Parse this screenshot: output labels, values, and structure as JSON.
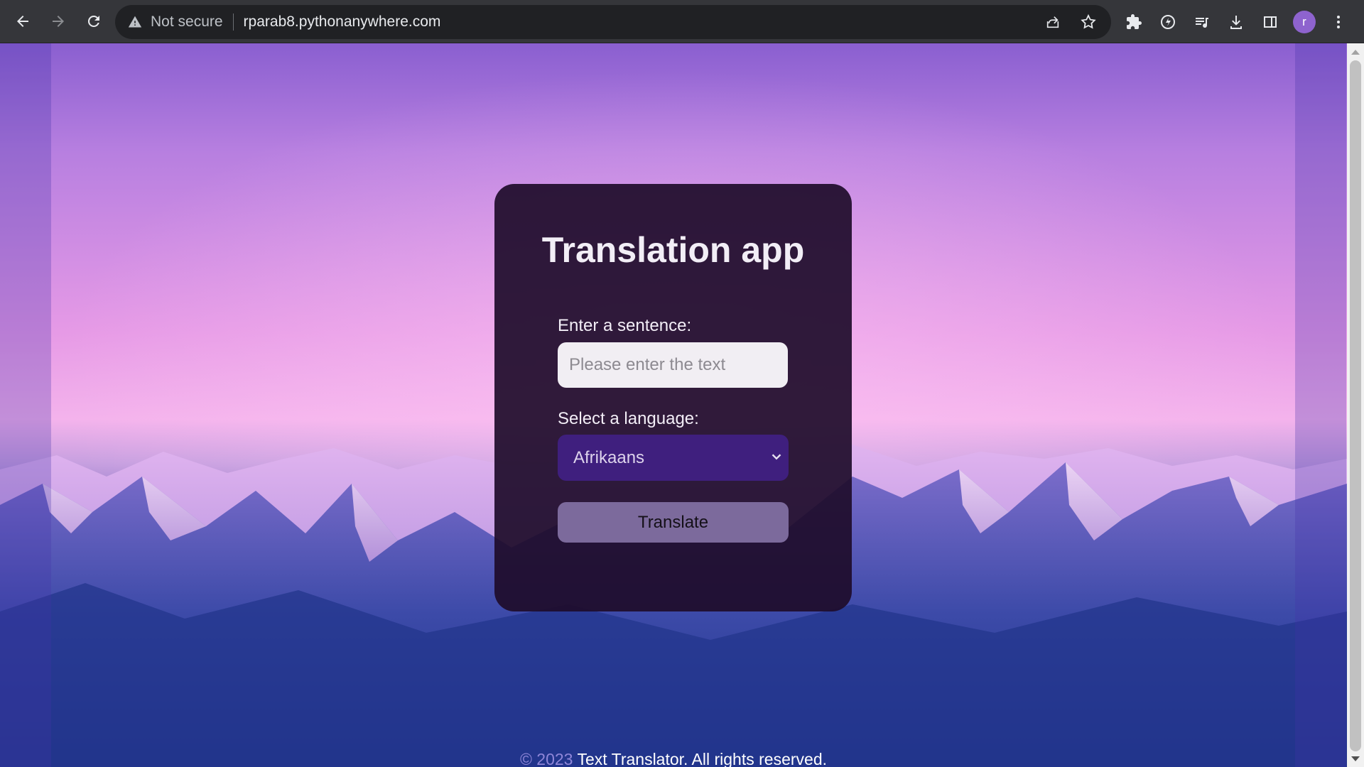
{
  "browser": {
    "security_label": "Not secure",
    "url": "rparab8.pythonanywhere.com",
    "profile_initial": "r",
    "profile_color": "#8e63ce"
  },
  "app": {
    "title": "Translation app",
    "sentence_label": "Enter a sentence:",
    "sentence_placeholder": "Please enter the text",
    "sentence_value": "",
    "language_label": "Select a language:",
    "language_selected": "Afrikaans",
    "translate_label": "Translate"
  },
  "footer": {
    "copyright": "© 2023",
    "text": "Text Translator. All rights reserved."
  },
  "colors": {
    "card_background": "#1e0c2a",
    "select_background": "#3f1f7e",
    "button_background": "#7c6a9c"
  },
  "icons": {
    "back": "arrow-left-icon",
    "forward": "arrow-right-icon",
    "reload": "reload-icon",
    "warning": "warning-triangle-icon",
    "share": "share-icon",
    "bookmark": "star-icon",
    "extensions": "puzzle-icon",
    "performance": "gauge-icon",
    "media": "media-queue-icon",
    "download": "download-icon",
    "side_panel": "side-panel-icon",
    "menu": "kebab-menu-icon",
    "select_arrow": "chevron-down-icon"
  }
}
